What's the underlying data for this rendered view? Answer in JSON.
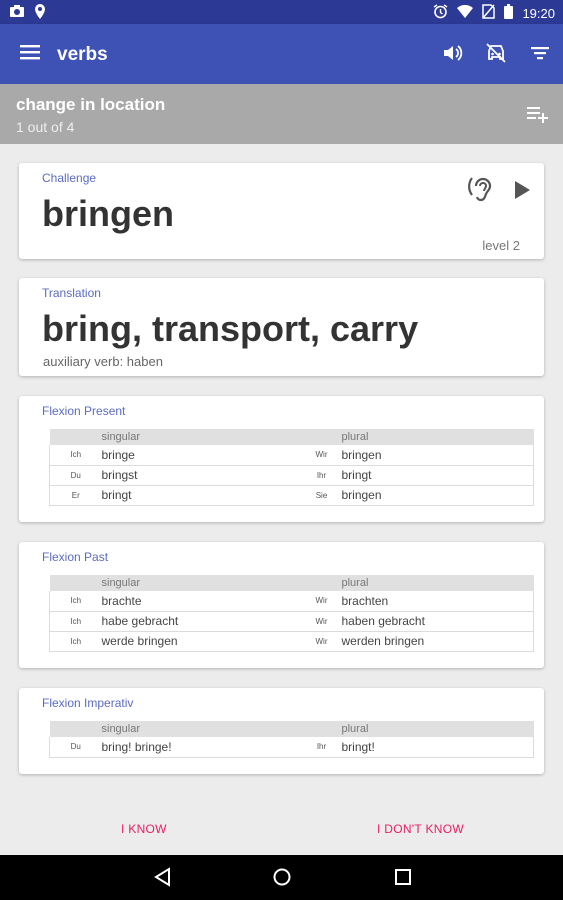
{
  "status_bar": {
    "time": "19:20"
  },
  "app_bar": {
    "title": "verbs"
  },
  "sub_header": {
    "title": "change in location",
    "count": "1 out of 4"
  },
  "challenge": {
    "label": "Challenge",
    "word": "bringen",
    "level": "level 2"
  },
  "translation": {
    "label": "Translation",
    "word": "bring, transport, carry",
    "auxiliary": "auxiliary verb: haben"
  },
  "flexion_present": {
    "label": "Flexion Present",
    "headers": [
      "singular",
      "plural"
    ],
    "rows": [
      {
        "p1": "Ich",
        "v1": "bringe",
        "p2": "Wir",
        "v2": "bringen"
      },
      {
        "p1": "Du",
        "v1": "bringst",
        "p2": "Ihr",
        "v2": "bringt"
      },
      {
        "p1": "Er",
        "v1": "bringt",
        "p2": "Sie",
        "v2": "bringen"
      }
    ]
  },
  "flexion_past": {
    "label": "Flexion Past",
    "headers": [
      "singular",
      "plural"
    ],
    "rows": [
      {
        "p1": "Ich",
        "v1": "brachte",
        "p2": "Wir",
        "v2": "brachten"
      },
      {
        "p1": "Ich",
        "v1": "habe gebracht",
        "p2": "Wir",
        "v2": "haben gebracht"
      },
      {
        "p1": "Ich",
        "v1": "werde bringen",
        "p2": "Wir",
        "v2": "werden bringen"
      }
    ]
  },
  "flexion_imperativ": {
    "label": "Flexion Imperativ",
    "headers": [
      "singular",
      "plural"
    ],
    "rows": [
      {
        "p1": "Du",
        "v1": "bring! bringe!",
        "p2": "Ihr",
        "v2": "bringt!"
      }
    ]
  },
  "actions": {
    "know": "I KNOW",
    "dont_know": "I DON'T KNOW"
  },
  "colors": {
    "status_bar": "#2c3a96",
    "app_bar": "#3e51b5",
    "sub_header": "#a9a9a9",
    "accent_label": "#5c6bc0",
    "action_text": "#e91e63"
  },
  "icons": {
    "status_left": [
      "camera-icon",
      "location-icon"
    ],
    "status_right": [
      "alarm-icon",
      "wifi-icon",
      "no-sim-icon",
      "battery-icon"
    ],
    "app_bar_left": "menu-icon",
    "app_bar_right": [
      "volume-icon",
      "no-car-icon",
      "filter-icon"
    ],
    "sub_header": "playlist-add-icon",
    "challenge": [
      "hearing-icon",
      "play-icon"
    ],
    "nav": [
      "back-icon",
      "home-icon",
      "recents-icon"
    ]
  }
}
